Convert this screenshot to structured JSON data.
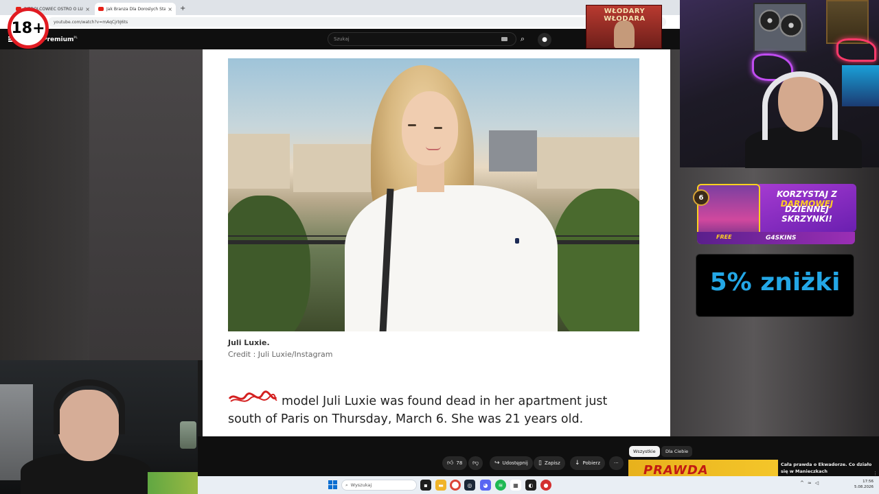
{
  "age_badge": "18+",
  "browser": {
    "tabs": [
      {
        "title": "PIZDOLCOWIEC OSTRO O LUDZIA"
      },
      {
        "title": "Jak Branza Dla Doroslych Stala"
      }
    ],
    "new_tab": "+",
    "url": "youtube.com/watch?v=mAqCjrbJ6ts"
  },
  "youtube": {
    "brand": "Premium",
    "region": "PL",
    "search_placeholder": "Szukaj"
  },
  "article": {
    "caption_name": "Juli Luxie.",
    "caption_credit": "Credit : Juli Luxie/Instagram",
    "paragraph": "model Juli Luxie was found dead in her apartment just south of Paris on Thursday, March 6. She was 21 years old."
  },
  "overlay": {
    "mini_thumb_title": "WŁODARY WŁODARA",
    "ad_line1_a": "KORZYSTAJ Z ",
    "ad_line1_b": "DARMOWEJ",
    "ad_line2": "DZIENNEJ SKRZYNKI!",
    "ad_free": "FREE",
    "ad_brand": "G4SKINS",
    "ad_badge": "6",
    "discount": "5% zniżki"
  },
  "actions": {
    "likes": "78",
    "share": "Udostępnij",
    "save": "Zapisz",
    "download": "Pobierz",
    "more": "···"
  },
  "chips": {
    "all": "Wszystkie",
    "for_you": "Dla Ciebie"
  },
  "recommendation": {
    "thumb_text": "PRAWDA",
    "title": "Cała prawda o Ekwadorze. Co działo się w Manieczkach"
  },
  "taskbar": {
    "search_placeholder": "Wyszukaj",
    "time": "17:56",
    "date": "5.08.2026"
  },
  "colors": {
    "youtube_bg": "#0f0f0f",
    "age_ring": "#e11b22",
    "discount_text": "#23a7e6",
    "ad_purple": "#a63bd1"
  }
}
